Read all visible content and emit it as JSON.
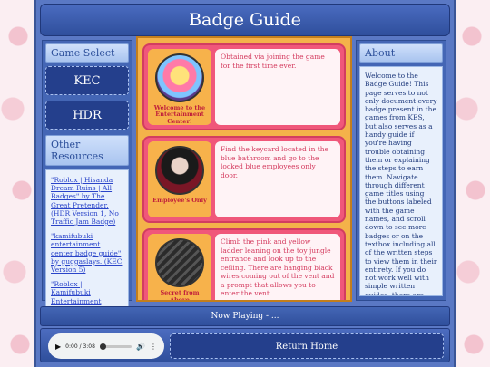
{
  "header": {
    "title": "Badge Guide"
  },
  "left": {
    "game_select_heading": "Game Select",
    "games": [
      "KEC",
      "HDR"
    ],
    "resources_heading": "Other Resources",
    "resources": [
      "\"Roblox | Hisanda Dream Ruins | All Badges\" by The Great Pretender. (HDR Version 1, No Traffic Jam Badge)",
      "\"kamifubuki entertainment center badge guide\" by guggaslays. (KEC Version 5)",
      "\"Roblox | Kamifubuki Entertainment Center | All Badges\" by The Great Pretender. (KEC Version 5, OUTDATED)"
    ]
  },
  "badges": [
    {
      "caption": "Welcome to the Entertainment Center!",
      "description": "Obtained via joining the game for the first time ever.",
      "image_icon": "welcome-badge-icon"
    },
    {
      "caption": "Employee's Only",
      "description": "Find the keycard located in the blue bathroom and go to the locked blue employees only door.",
      "image_icon": "employee-badge-icon"
    },
    {
      "caption": "Secret from Above",
      "description": "Climb the pink and yellow ladder leaning on the toy jungle entrance and look up to the ceiling. There are hanging black wires coming out of the vent and a prompt that allows you to enter the vent.",
      "image_icon": "vent-badge-icon"
    }
  ],
  "right": {
    "about_heading": "About",
    "about_text": "Welcome to the Badge Guide! This page serves to not only document every badge present in the games from KES, but also serves as a handy guide if you're having trouble obtaining them or explaining the steps to earn them. Navigate through different game titles using the buttons labeled with the game names, and scroll down to see more badges or on the textbox including all of the written steps to view them in their entirety. If you do not work well with simple written guides, there are also fanmade videos linked in the \"Other Resources\" section of this page. They will be marked as version of the game, and may be marked \"OUTDATED\" if"
  },
  "player": {
    "now_playing": "Now Playing - ...",
    "time": "0:00 / 3:08"
  },
  "footer": {
    "home_label": "Return Home"
  },
  "colors": {
    "frame": "#5a78c4",
    "title_bar": "#2f4f9c",
    "badge_panel": "#f4b24a",
    "badge_card": "#f0577a",
    "button": "#243f8c"
  }
}
